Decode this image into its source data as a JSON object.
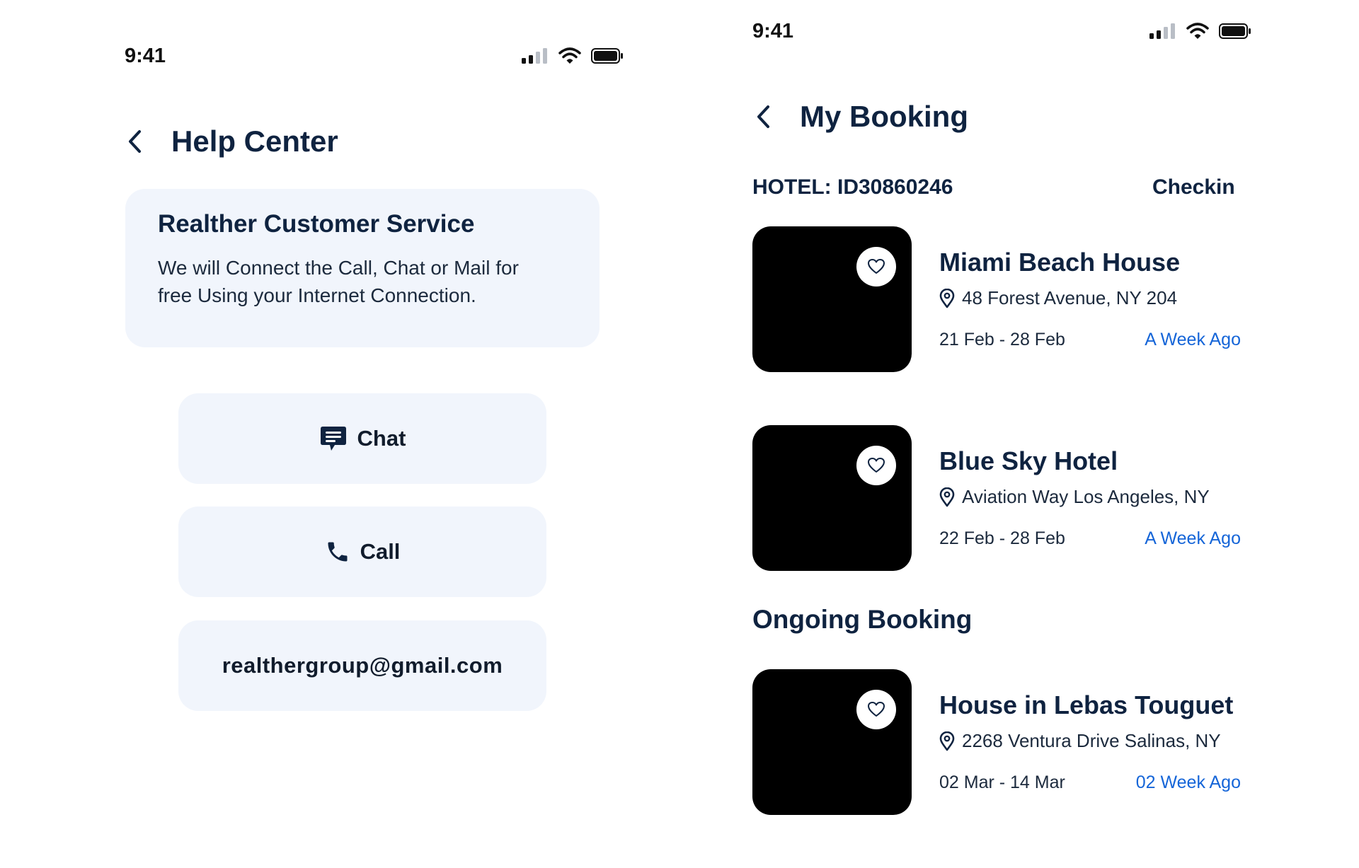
{
  "help_screen": {
    "time": "9:41",
    "title": "Help Center",
    "card": {
      "title": "Realther Customer Service",
      "text": "We will Connect the Call, Chat or Mail for free Using your Internet Connection."
    },
    "buttons": {
      "chat_label": "Chat",
      "call_label": "Call",
      "email_label": "realthergroup@gmail.com"
    }
  },
  "booking_screen": {
    "time": "9:41",
    "title": "My Booking",
    "hotel_id": "HOTEL: ID30860246",
    "checkin_label": "Checkin",
    "ongoing_label": "Ongoing Booking",
    "bookings": [
      {
        "name": "Miami Beach House",
        "address": "48 Forest Avenue, NY 204",
        "dates": "21 Feb - 28 Feb",
        "ago": "A Week Ago"
      },
      {
        "name": "Blue Sky Hotel",
        "address": "Aviation Way Los Angeles, NY",
        "dates": "22 Feb - 28 Feb",
        "ago": "A Week Ago"
      },
      {
        "name": "House in Lebas Touguet",
        "address": "2268 Ventura Drive Salinas, NY",
        "dates": "02 Mar - 14 Mar",
        "ago": "02 Week Ago"
      }
    ]
  },
  "icons": {
    "status": [
      "signal-icon",
      "wifi-icon",
      "battery-icon"
    ],
    "back": "chevron-left-icon",
    "chat": "chat-bubble-icon",
    "call": "phone-icon",
    "location": "location-pin-icon",
    "favorite": "heart-icon"
  },
  "colors": {
    "primary_text": "#0f2340",
    "card_bg": "#f1f5fc",
    "link_blue": "#1565d8",
    "thumbnail": "#000000"
  }
}
